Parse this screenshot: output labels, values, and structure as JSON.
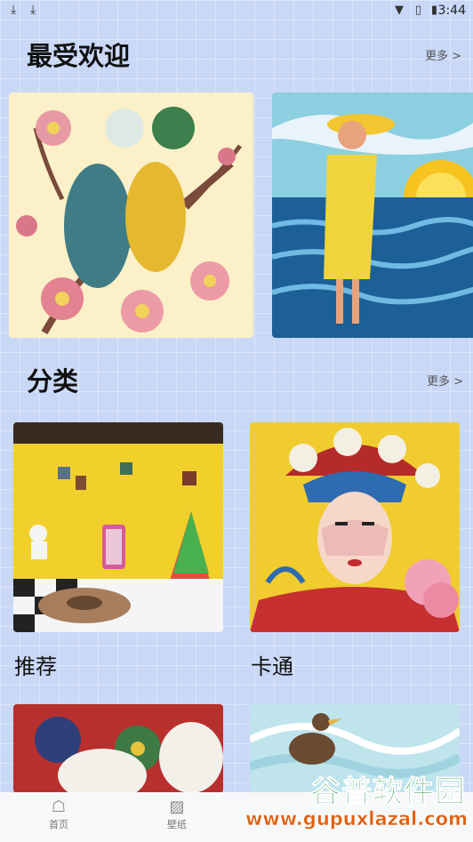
{
  "status_bar": {
    "time": "3:44"
  },
  "sections": {
    "popular": {
      "title": "最受欢迎",
      "more": "更多 >"
    },
    "categories": {
      "title": "分类",
      "more": "更多 >"
    }
  },
  "category_items": [
    {
      "label": "推荐"
    },
    {
      "label": "卡通"
    }
  ],
  "tabs": [
    {
      "label": "首页",
      "icon": "ghost-icon"
    },
    {
      "label": "壁纸",
      "icon": "image-icon"
    }
  ],
  "watermark": {
    "title": "谷普软件园",
    "url": "www.gupuxlazal.com"
  }
}
